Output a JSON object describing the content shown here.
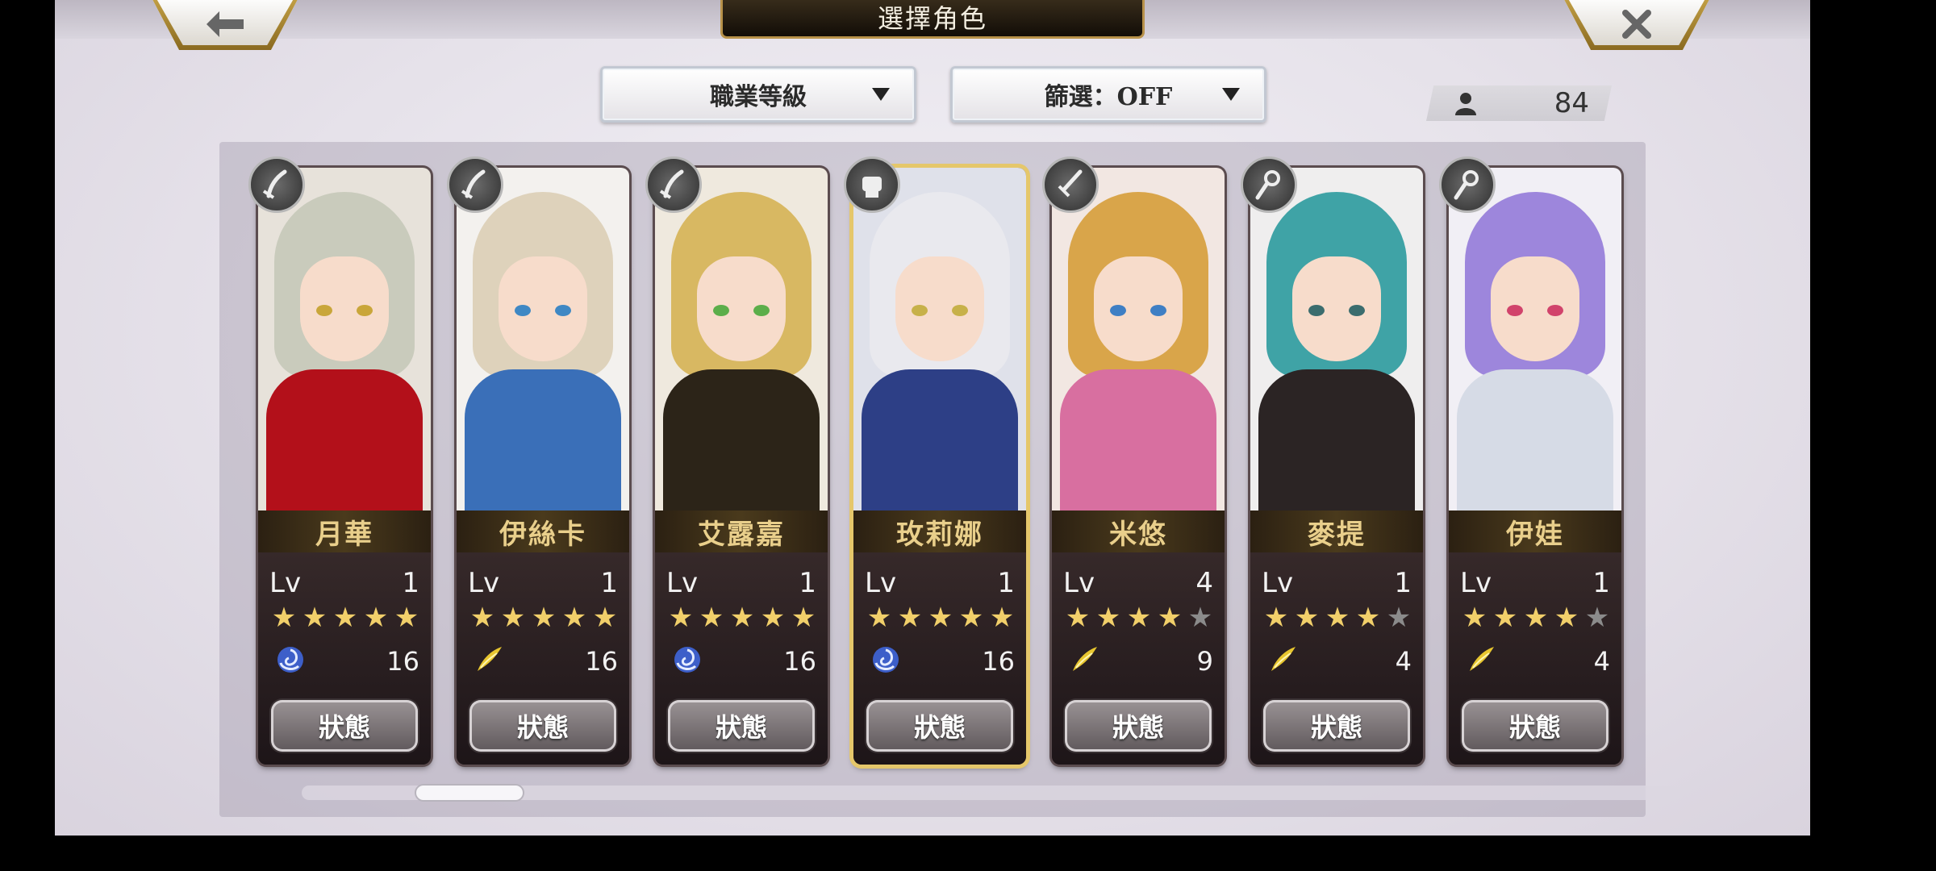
{
  "header": {
    "title": "選擇角色",
    "back_icon": "arrow-left-icon",
    "close_icon": "close-x-icon"
  },
  "filters": {
    "job_level_label": "職業等級",
    "filter_label": "篩選：OFF"
  },
  "roster_count": "84",
  "colors": {
    "accent_gold": "#e5c76b",
    "name_gold": "#e9cf8b",
    "star_gold": "#f1cf6a"
  },
  "characters": [
    {
      "name": "月華",
      "class_icon": "blade-icon",
      "lv_label": "Lv",
      "level": "1",
      "stars": 5,
      "max_stars": 5,
      "element_icon": "swirl-icon",
      "value": "16",
      "status_label": "狀態",
      "hair": "#c9cbbc",
      "outfit": "#b3101a",
      "eye": "#c9a63a",
      "bg": "#e7e2da"
    },
    {
      "name": "伊絲卡",
      "class_icon": "blade-icon",
      "lv_label": "Lv",
      "level": "1",
      "stars": 5,
      "max_stars": 5,
      "element_icon": "wing-icon",
      "value": "16",
      "status_label": "狀態",
      "hair": "#ded2bb",
      "outfit": "#3a6fb8",
      "eye": "#3f88c4",
      "bg": "#f3f1ee"
    },
    {
      "name": "艾露嘉",
      "class_icon": "blade-icon",
      "lv_label": "Lv",
      "level": "1",
      "stars": 5,
      "max_stars": 5,
      "element_icon": "swirl-icon",
      "value": "16",
      "status_label": "狀態",
      "hair": "#d8b862",
      "outfit": "#2c2418",
      "eye": "#5cae4a",
      "bg": "#efe9de"
    },
    {
      "name": "玫莉娜",
      "class_icon": "fist-icon",
      "lv_label": "Lv",
      "level": "1",
      "stars": 5,
      "max_stars": 5,
      "element_icon": "swirl-icon",
      "value": "16",
      "status_label": "狀態",
      "hair": "#e9e9ee",
      "outfit": "#2d3f86",
      "eye": "#c7b14a",
      "bg": "#dfe1ea",
      "selected": true
    },
    {
      "name": "米悠",
      "class_icon": "sword-icon",
      "lv_label": "Lv",
      "level": "4",
      "stars": 4,
      "max_stars": 5,
      "element_icon": "wing-icon",
      "value": "9",
      "status_label": "狀態",
      "hair": "#d9a54a",
      "outfit": "#d86fa0",
      "eye": "#3f7fc4",
      "bg": "#f2e7e2"
    },
    {
      "name": "麥提",
      "class_icon": "staff-icon",
      "lv_label": "Lv",
      "level": "1",
      "stars": 4,
      "max_stars": 5,
      "element_icon": "wing-icon",
      "value": "4",
      "status_label": "狀態",
      "hair": "#3fa3a6",
      "outfit": "#2b2424",
      "eye": "#3b6d6e",
      "bg": "#efeeee"
    },
    {
      "name": "伊娃",
      "class_icon": "staff-icon",
      "lv_label": "Lv",
      "level": "1",
      "stars": 4,
      "max_stars": 5,
      "element_icon": "wing-icon",
      "value": "4",
      "status_label": "狀態",
      "hair": "#9d86dc",
      "outfit": "#d6dbe6",
      "eye": "#d1436b",
      "bg": "#f1eff5"
    }
  ]
}
